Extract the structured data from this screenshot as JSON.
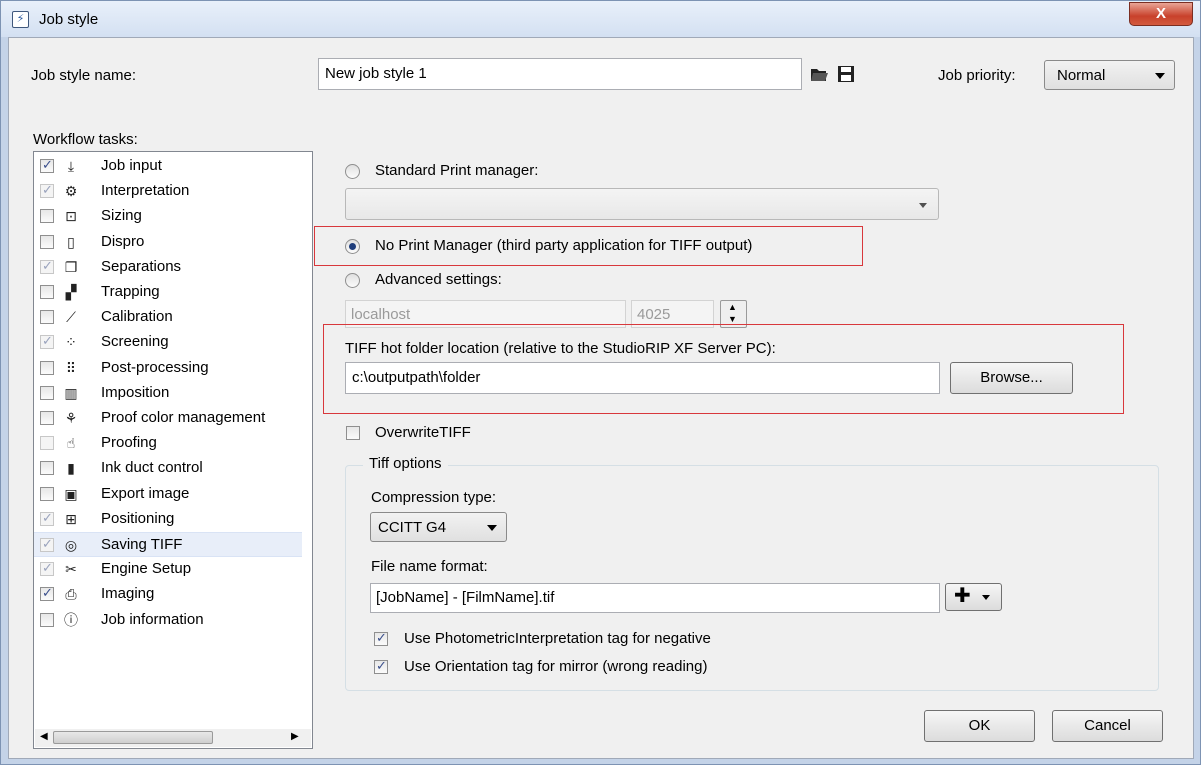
{
  "window": {
    "title": "Job style",
    "close_label": "X"
  },
  "header": {
    "name_label": "Job style name:",
    "name_value": "New job style 1",
    "priority_label": "Job priority:",
    "priority_value": "Normal"
  },
  "tasks": {
    "label": "Workflow tasks:",
    "items": [
      {
        "label": "Job input",
        "icon": "download-icon",
        "checked": true,
        "enabled": true
      },
      {
        "label": "Interpretation",
        "icon": "gears-icon",
        "checked": true,
        "enabled": false
      },
      {
        "label": "Sizing",
        "icon": "sizing-icon",
        "checked": false,
        "enabled": true
      },
      {
        "label": "Dispro",
        "icon": "page-icon",
        "checked": false,
        "enabled": true
      },
      {
        "label": "Separations",
        "icon": "separations-icon",
        "checked": true,
        "enabled": false
      },
      {
        "label": "Trapping",
        "icon": "trapping-icon",
        "checked": false,
        "enabled": true
      },
      {
        "label": "Calibration",
        "icon": "curve-icon",
        "checked": false,
        "enabled": true
      },
      {
        "label": "Screening",
        "icon": "dots-icon",
        "checked": true,
        "enabled": false
      },
      {
        "label": "Post-processing",
        "icon": "grid-dots-icon",
        "checked": false,
        "enabled": true
      },
      {
        "label": "Imposition",
        "icon": "book-icon",
        "checked": false,
        "enabled": true
      },
      {
        "label": "Proof color management",
        "icon": "color-check-icon",
        "checked": false,
        "enabled": true
      },
      {
        "label": "Proofing",
        "icon": "hand-icon",
        "checked": false,
        "enabled": false
      },
      {
        "label": "Ink duct control",
        "icon": "bars-icon",
        "checked": false,
        "enabled": true
      },
      {
        "label": "Export image",
        "icon": "image-icon",
        "checked": false,
        "enabled": true
      },
      {
        "label": "Positioning",
        "icon": "positioning-icon",
        "checked": true,
        "enabled": false
      },
      {
        "label": "Saving TIFF",
        "icon": "saving-tiff-icon",
        "checked": true,
        "enabled": false
      },
      {
        "label": "Engine Setup",
        "icon": "tools-icon",
        "checked": true,
        "enabled": false
      },
      {
        "label": "Imaging",
        "icon": "printer-icon",
        "checked": true,
        "enabled": true
      },
      {
        "label": "Job information",
        "icon": "info-icon",
        "checked": false,
        "enabled": true
      }
    ]
  },
  "print": {
    "standard_label": "Standard Print manager:",
    "none_label": "No Print Manager (third party application for TIFF output)",
    "advanced_label": "Advanced settings:",
    "host_value": "localhost",
    "port_value": "4025",
    "selected": "none"
  },
  "tiff_folder": {
    "label": "TIFF hot folder location (relative to the StudioRIP XF Server PC):",
    "value": "c:\\outputpath\\folder",
    "browse_label": "Browse..."
  },
  "overwrite": {
    "label": "OverwriteTIFF",
    "checked": false
  },
  "tiff_options": {
    "title": "Tiff options",
    "compression_label": "Compression type:",
    "compression_value": "CCITT G4",
    "filename_label": "File name format:",
    "filename_value": "[JobName] - [FilmName].tif",
    "photometric_label": "Use PhotometricInterpretation tag for negative",
    "photometric_checked": true,
    "orientation_label": "Use Orientation tag for mirror (wrong reading)",
    "orientation_checked": true
  },
  "footer": {
    "ok_label": "OK",
    "cancel_label": "Cancel"
  },
  "colors": {
    "highlight": "#d8383c",
    "selected_row": "#e8eef9",
    "radio_dot": "#1e3d7b"
  }
}
